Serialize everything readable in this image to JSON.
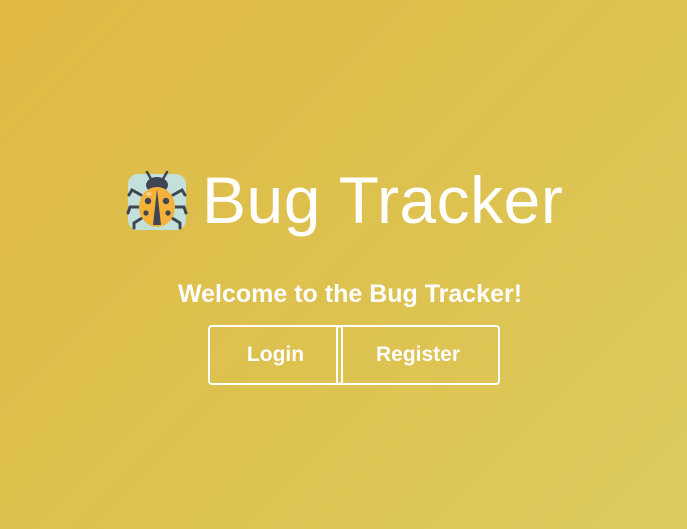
{
  "header": {
    "title": "Bug Tracker",
    "icon": "ladybug-icon"
  },
  "main": {
    "welcome_text": "Welcome to the Bug Tracker!",
    "buttons": {
      "login_label": "Login",
      "register_label": "Register"
    }
  },
  "colors": {
    "background_start": "#e0b944",
    "background_end": "#dccb5e",
    "foreground": "#ffffff",
    "bug_body": "#f4b23a",
    "bug_dark": "#3f4652",
    "bug_glow": "#bfe6f5"
  }
}
